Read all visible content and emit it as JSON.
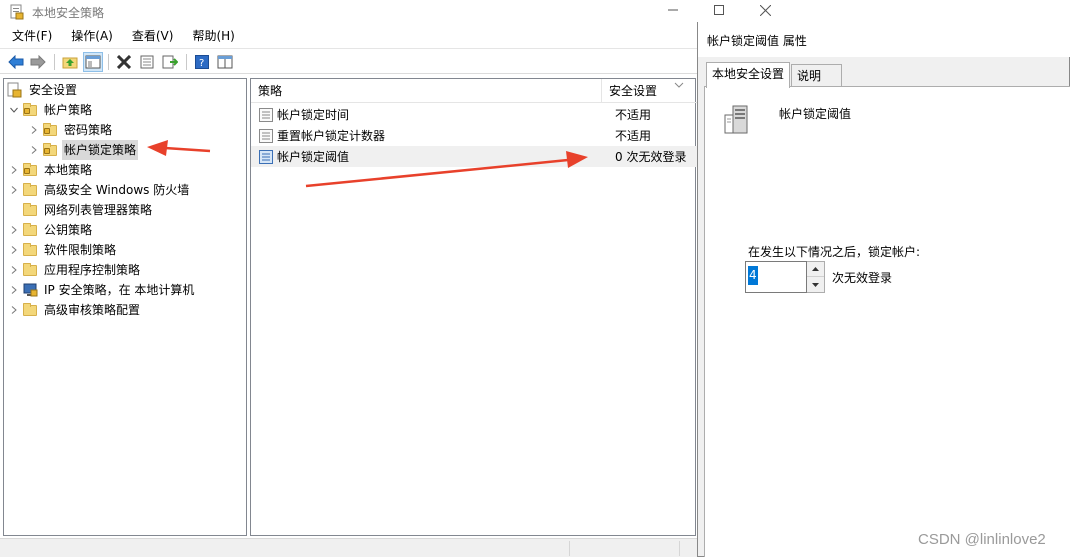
{
  "window": {
    "title": "本地安全策略"
  },
  "menu": [
    {
      "label": "文件(F)"
    },
    {
      "label": "操作(A)"
    },
    {
      "label": "查看(V)"
    },
    {
      "label": "帮助(H)"
    }
  ],
  "toolbar_icons": [
    "back-arrow-icon",
    "forward-arrow-icon",
    "up-folder-icon",
    "show-hide-tree-icon",
    "delete-icon",
    "properties-icon",
    "export-list-icon",
    "help-icon",
    "console-tree-icon"
  ],
  "tree": {
    "root": "安全设置",
    "account_policies": "帐户策略",
    "password_policy": "密码策略",
    "lockout_policy": "帐户锁定策略",
    "local_policies": "本地策略",
    "firewall": "高级安全 Windows 防火墙",
    "network_list": "网络列表管理器策略",
    "public_key": "公钥策略",
    "software_restriction": "软件限制策略",
    "applocker": "应用程序控制策略",
    "ipsec": "IP 安全策略，在 本地计算机",
    "audit": "高级审核策略配置"
  },
  "list": {
    "col_policy": "策略",
    "col_setting": "安全设置",
    "rows": [
      {
        "policy": "帐户锁定时间",
        "setting": "不适用"
      },
      {
        "policy": "重置帐户锁定计数器",
        "setting": "不适用"
      },
      {
        "policy": "帐户锁定阈值",
        "setting": "0 次无效登录"
      }
    ]
  },
  "dialog": {
    "title": "帐户锁定阈值 属性",
    "tab_local": "本地安全设置",
    "tab_explain": "说明",
    "policy_name": "帐户锁定阈值",
    "lockout_label": "在发生以下情况之后，锁定帐户:",
    "threshold_value": "4",
    "threshold_suffix": "次无效登录"
  },
  "watermark": "CSDN @linlinlove2",
  "colors": {
    "selection": "#0078d7",
    "arrow": "#e8412b",
    "folder": "#f3d77a"
  }
}
